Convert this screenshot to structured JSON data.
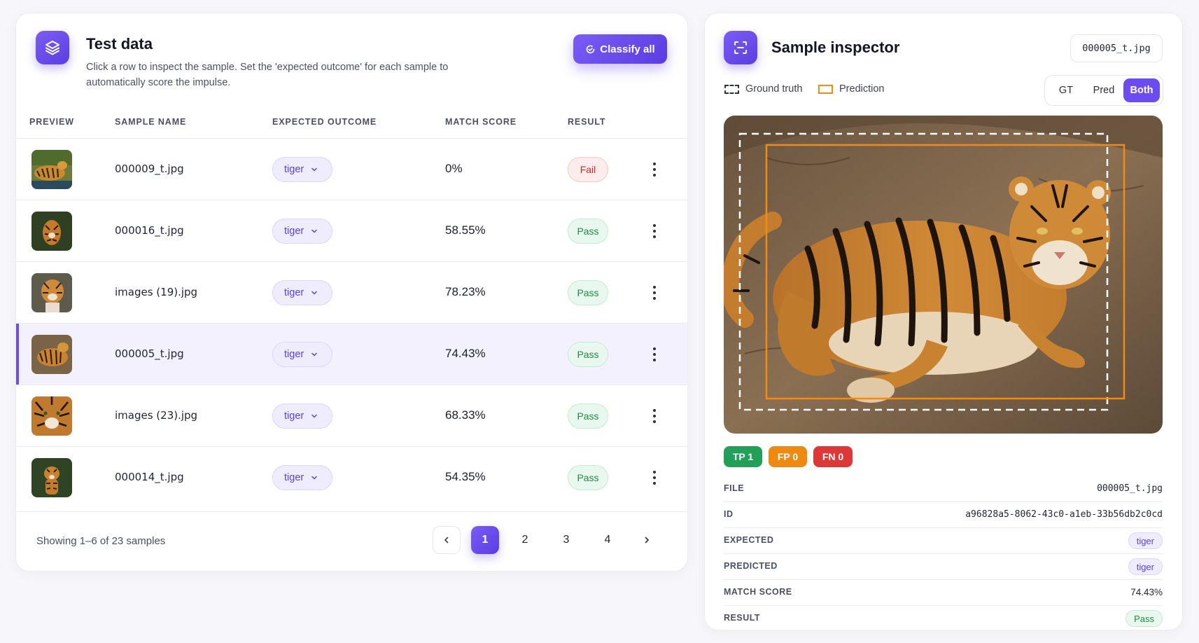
{
  "left_panel": {
    "title": "Test data",
    "subtitle": "Click a row to inspect the sample. Set the 'expected outcome' for each sample to automatically score the impulse.",
    "classify_button": "Classify all",
    "columns": [
      "PREVIEW",
      "SAMPLE NAME",
      "EXPECTED OUTCOME",
      "MATCH SCORE",
      "RESULT"
    ],
    "rows": [
      {
        "name": "000009_t.jpg",
        "outcome": "tiger",
        "score": "0%",
        "result": "Fail",
        "status": "fail",
        "thumb": "tiger-thumb-1",
        "selected": false
      },
      {
        "name": "000016_t.jpg",
        "outcome": "tiger",
        "score": "58.55%",
        "result": "Pass",
        "status": "pass",
        "thumb": "tiger-thumb-2",
        "selected": false
      },
      {
        "name": "images (19).jpg",
        "outcome": "tiger",
        "score": "78.23%",
        "result": "Pass",
        "status": "pass",
        "thumb": "tiger-thumb-3",
        "selected": false
      },
      {
        "name": "000005_t.jpg",
        "outcome": "tiger",
        "score": "74.43%",
        "result": "Pass",
        "status": "pass",
        "thumb": "tiger-thumb-4",
        "selected": true
      },
      {
        "name": "images (23).jpg",
        "outcome": "tiger",
        "score": "68.33%",
        "result": "Pass",
        "status": "pass",
        "thumb": "tiger-thumb-5",
        "selected": false
      },
      {
        "name": "000014_t.jpg",
        "outcome": "tiger",
        "score": "54.35%",
        "result": "Pass",
        "status": "pass",
        "thumb": "tiger-thumb-6",
        "selected": false
      }
    ],
    "pagination": {
      "showing": "Showing 1–6 of 23 samples",
      "pages": [
        "1",
        "2",
        "3",
        "4"
      ],
      "current": "1",
      "prev_icon": "chevron-left-icon",
      "next_icon": "chevron-right-icon"
    }
  },
  "right_panel": {
    "title": "Sample inspector",
    "file_chip": "000005_t.jpg",
    "legend": {
      "ground_truth": "Ground truth",
      "prediction": "Prediction"
    },
    "view_toggle": {
      "options": [
        "GT",
        "Pred",
        "Both"
      ],
      "active": "Both"
    },
    "counts": {
      "tp": "TP 1",
      "fp": "FP 0",
      "fn": "FN 0"
    },
    "meta": {
      "file_label": "FILE",
      "file": "000005_t.jpg",
      "id_label": "ID",
      "id": "a96828a5-8062-43c0-a1eb-33b56db2c0cd",
      "expected_label": "EXPECTED",
      "expected": "tiger",
      "predicted_label": "PREDICTED",
      "predicted": "tiger",
      "score_label": "MATCH SCORE",
      "score": "74.43%",
      "result_label": "RESULT",
      "result": "Pass"
    }
  },
  "colors": {
    "accent": "#6a4cf0",
    "pass": "#1f8a48",
    "fail": "#d02828",
    "prediction_box": "#f08a1a",
    "tp_chip": "#22a05a",
    "fp_chip": "#ee8a12",
    "fn_chip": "#dc3838"
  }
}
